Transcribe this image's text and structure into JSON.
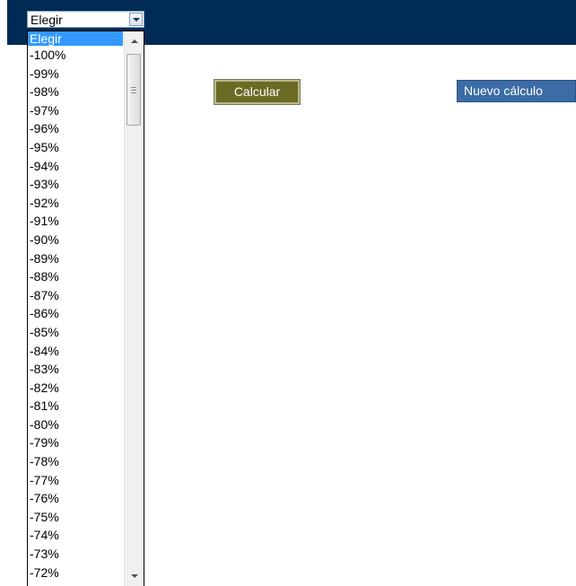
{
  "header": {
    "background_color": "#002b55"
  },
  "select": {
    "current_value": "Elegir",
    "arrow_icon": "chevron-down-icon",
    "options": [
      "Elegir",
      "-100%",
      "-99%",
      "-98%",
      "-97%",
      "-96%",
      "-95%",
      "-94%",
      "-93%",
      "-92%",
      "-91%",
      "-90%",
      "-89%",
      "-88%",
      "-87%",
      "-86%",
      "-85%",
      "-84%",
      "-83%",
      "-82%",
      "-81%",
      "-80%",
      "-79%",
      "-78%",
      "-77%",
      "-76%",
      "-75%",
      "-74%",
      "-73%",
      "-72%"
    ],
    "highlighted_option": "Elegir",
    "highlight_color": "#3399ff"
  },
  "buttons": {
    "calcular_label": "Calcular",
    "calcular_color": "#6b6a24",
    "nuevo_label": "Nuevo cálculo",
    "nuevo_color": "#3b6ca5"
  }
}
